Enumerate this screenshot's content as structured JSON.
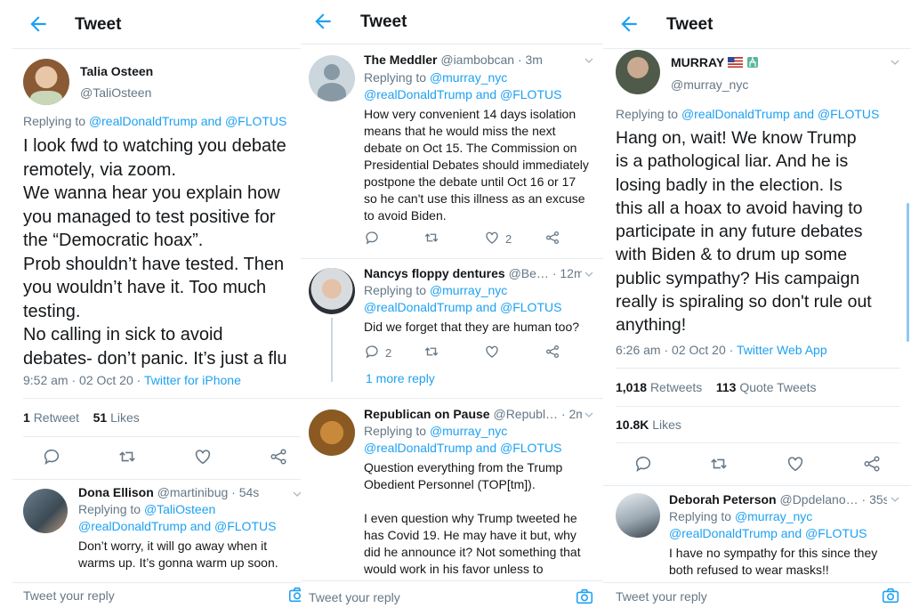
{
  "colors": {
    "accent": "#1da1f2",
    "muted": "#657786",
    "text": "#14171a",
    "divider": "#e6ecf0"
  },
  "panel1": {
    "header_title": "Tweet",
    "author_name": "Talia Osteen",
    "author_handle": "@TaliOsteen",
    "replying_prefix": "Replying to",
    "replying_to_1": "@realDonaldTrump",
    "replying_and": "and",
    "replying_to_2": "@FLOTUS",
    "text_lines": [
      "I look fwd to watching you debate",
      "remotely, via zoom.",
      "We wanna hear you explain how",
      "you managed to test positive for",
      "the “Democratic hoax”.",
      "Prob shouldn’t have tested. Then",
      "you wouldn’t have it. Too much",
      "testing.",
      "No calling in sick to avoid",
      "debates- don’t panic. It’s just a flu"
    ],
    "timestamp": "9:52 am · 02 Oct 20 ·",
    "source": "Twitter for iPhone",
    "retweets_count": "1",
    "retweets_label": "Retweet",
    "likes_count": "51",
    "likes_label": "Likes",
    "reply": {
      "name": "Dona Ellison",
      "handle_time": "@martinibug · 54s",
      "replying_prefix": "Replying to",
      "replying_to_1": "@TaliOsteen",
      "replying_to_2": "@realDonaldTrump",
      "replying_and": "and",
      "replying_to_3": "@FLOTUS",
      "text_lines": [
        "Don’t worry, it will go away when it",
        "warms up. It’s gonna warm up soon."
      ]
    },
    "reply_placeholder": "Tweet your reply"
  },
  "panel2": {
    "header_title": "Tweet",
    "tweets": [
      {
        "name": "The Meddler",
        "handle_time": "@iambobcan · 3m",
        "replying_prefix": "Replying to",
        "replying_to_1": "@murray_nyc",
        "replying_to_2": "@realDonaldTrump",
        "replying_and": "and",
        "replying_to_3": "@FLOTUS",
        "text_lines": [
          "How very convenient 14 days isolation",
          "means that he would miss the next",
          "debate on Oct 15. The Commission  on",
          "Presidential Debates should immediately",
          "postpone the debate until Oct 16 or 17",
          "so he can't use this illness as an excuse",
          "to avoid Biden."
        ],
        "like_count": "2"
      },
      {
        "name": "Nancys floppy dentures",
        "handle_time": "@Be… · 12m",
        "replying_prefix": "Replying to",
        "replying_to_1": "@murray_nyc",
        "replying_to_2": "@realDonaldTrump",
        "replying_and": "and",
        "replying_to_3": "@FLOTUS",
        "text_lines": [
          "Did we forget that they are human too?"
        ],
        "reply_count": "2",
        "more_replies": "1 more reply"
      },
      {
        "name": "Republican on Pause",
        "handle_time": "@Republ… · 2m",
        "replying_prefix": "Replying to",
        "replying_to_1": "@murray_nyc",
        "replying_to_2": "@realDonaldTrump",
        "replying_and": "and",
        "replying_to_3": "@FLOTUS",
        "text_lines": [
          "Question everything from the Trump",
          "Obedient Personnel  (TOP[tm]).",
          "",
          "I even question why Trump tweeted he",
          "has Covid 19. He may have it but, why",
          "did he announce it? Not something that",
          "would work in his favor unless to"
        ]
      }
    ],
    "reply_placeholder": "Tweet your reply"
  },
  "panel3": {
    "header_title": "Tweet",
    "author_name": "MURRAY",
    "author_handle": "@murray_nyc",
    "replying_prefix": "Replying to",
    "replying_to_1": "@realDonaldTrump",
    "replying_and": "and",
    "replying_to_2": "@FLOTUS",
    "text_lines": [
      "Hang on, wait! We know Trump",
      "is a pathological liar. And he is",
      "losing badly in the election. Is",
      "this all a hoax to avoid having to",
      "participate in any future debates",
      "with Biden & to drum up some",
      "public sympathy? His campaign",
      "really is spiraling so don't rule out",
      "anything!"
    ],
    "timestamp": "6:26 am · 02 Oct 20 ·",
    "source": "Twitter Web App",
    "retweets_count": "1,018",
    "retweets_label": "Retweets",
    "quotes_count": "113",
    "quotes_label": "Quote Tweets",
    "likes_count": "10.8K",
    "likes_label": "Likes",
    "reply": {
      "name": "Deborah Peterson",
      "handle_time": "@Dpdelano… · 35s",
      "replying_prefix": "Replying to",
      "replying_to_1": "@murray_nyc",
      "replying_to_2": "@realDonaldTrump",
      "replying_and": "and",
      "replying_to_3": "@FLOTUS",
      "text_lines": [
        "I have no sympathy for this since they",
        "both refused to wear masks!!"
      ]
    },
    "reply_placeholder": "Tweet your reply"
  }
}
